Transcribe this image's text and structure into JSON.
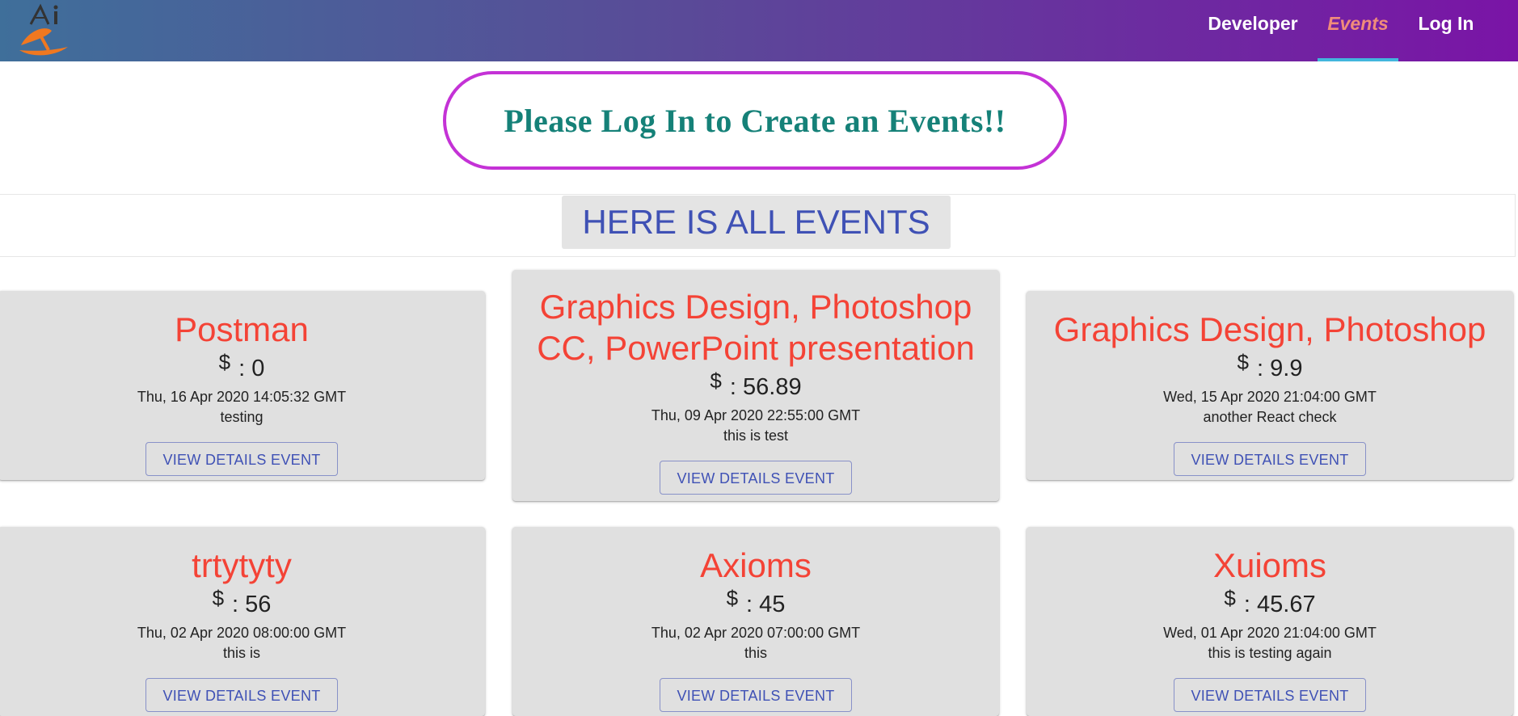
{
  "nav": {
    "items": [
      {
        "label": "Developer"
      },
      {
        "label": "Events"
      },
      {
        "label": "Log In"
      }
    ],
    "active": "Events"
  },
  "banner": {
    "text": "Please Log In to Create an Events!!"
  },
  "events_heading": "HERE IS ALL EVENTS",
  "currency_symbol": "$",
  "button_label": "VIEW DETAILS EVENT",
  "events": [
    {
      "title": "Postman",
      "price": ": 0",
      "date": "Thu, 16 Apr 2020 14:05:32 GMT",
      "description": "testing"
    },
    {
      "title": "Graphics Design, Photoshop CC, PowerPoint presentation",
      "price": ": 56.89",
      "date": "Thu, 09 Apr 2020 22:55:00 GMT",
      "description": "this is test"
    },
    {
      "title": "Graphics Design, Photoshop",
      "price": ": 9.9",
      "date": "Wed, 15 Apr 2020 21:04:00 GMT",
      "description": "another React check"
    },
    {
      "title": "trtytyty",
      "price": ": 56",
      "date": "Thu, 02 Apr 2020 08:00:00 GMT",
      "description": "this is"
    },
    {
      "title": "Axioms",
      "price": ": 45",
      "date": "Thu, 02 Apr 2020 07:00:00 GMT",
      "description": "this"
    },
    {
      "title": "Xuioms",
      "price": ": 45.67",
      "date": "Wed, 01 Apr 2020 21:04:00 GMT",
      "description": "this is testing again"
    }
  ],
  "colors": {
    "nav_gradient_start": "#3f6f9a",
    "nav_gradient_end": "#7a14a6",
    "active_nav": "#f08c7a",
    "nav_underline": "#42b6dd",
    "banner_border": "#c432d6",
    "banner_text": "#158178",
    "heading_text": "#3f51b5",
    "card_title": "#f44336",
    "card_bg": "#e0e0e0"
  }
}
